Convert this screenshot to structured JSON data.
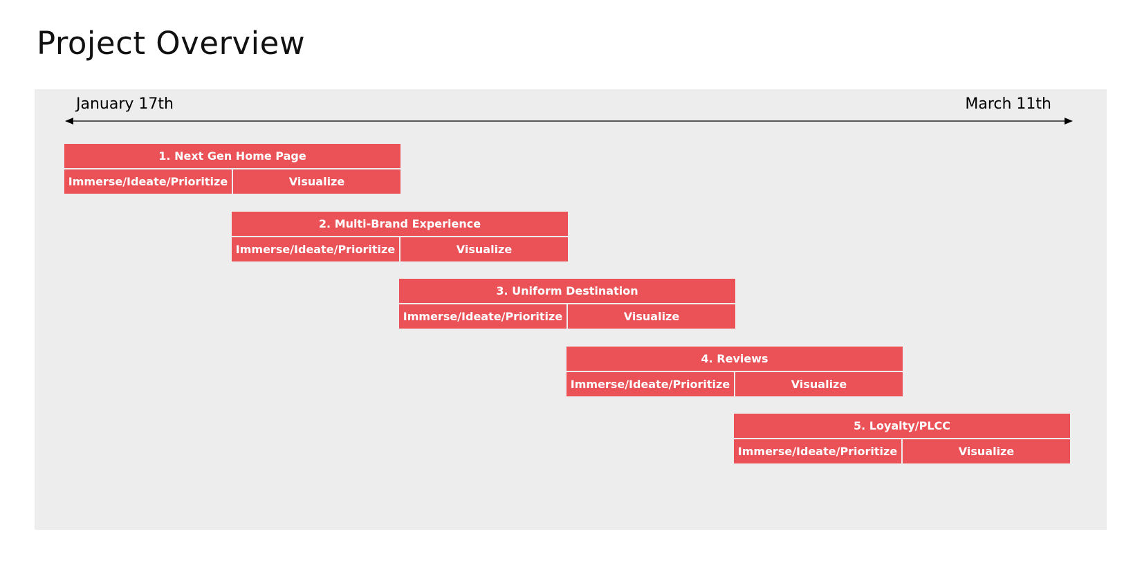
{
  "page": {
    "title": "Project Overview"
  },
  "timeline": {
    "start_label": "January 17th",
    "end_label": "March 11th",
    "bar_color": "#eb5257",
    "panel_color": "#ededed"
  },
  "projects": [
    {
      "title": "1. Next Gen Home Page",
      "phases": [
        "Immerse/Ideate/Prioritize",
        "Visualize"
      ]
    },
    {
      "title": "2. Multi-Brand Experience",
      "phases": [
        "Immerse/Ideate/Prioritize",
        "Visualize"
      ]
    },
    {
      "title": "3. Uniform Destination",
      "phases": [
        "Immerse/Ideate/Prioritize",
        "Visualize"
      ]
    },
    {
      "title": "4. Reviews",
      "phases": [
        "Immerse/Ideate/Prioritize",
        "Visualize"
      ]
    },
    {
      "title": "5. Loyalty/PLCC",
      "phases": [
        "Immerse/Ideate/Prioritize",
        "Visualize"
      ]
    }
  ]
}
